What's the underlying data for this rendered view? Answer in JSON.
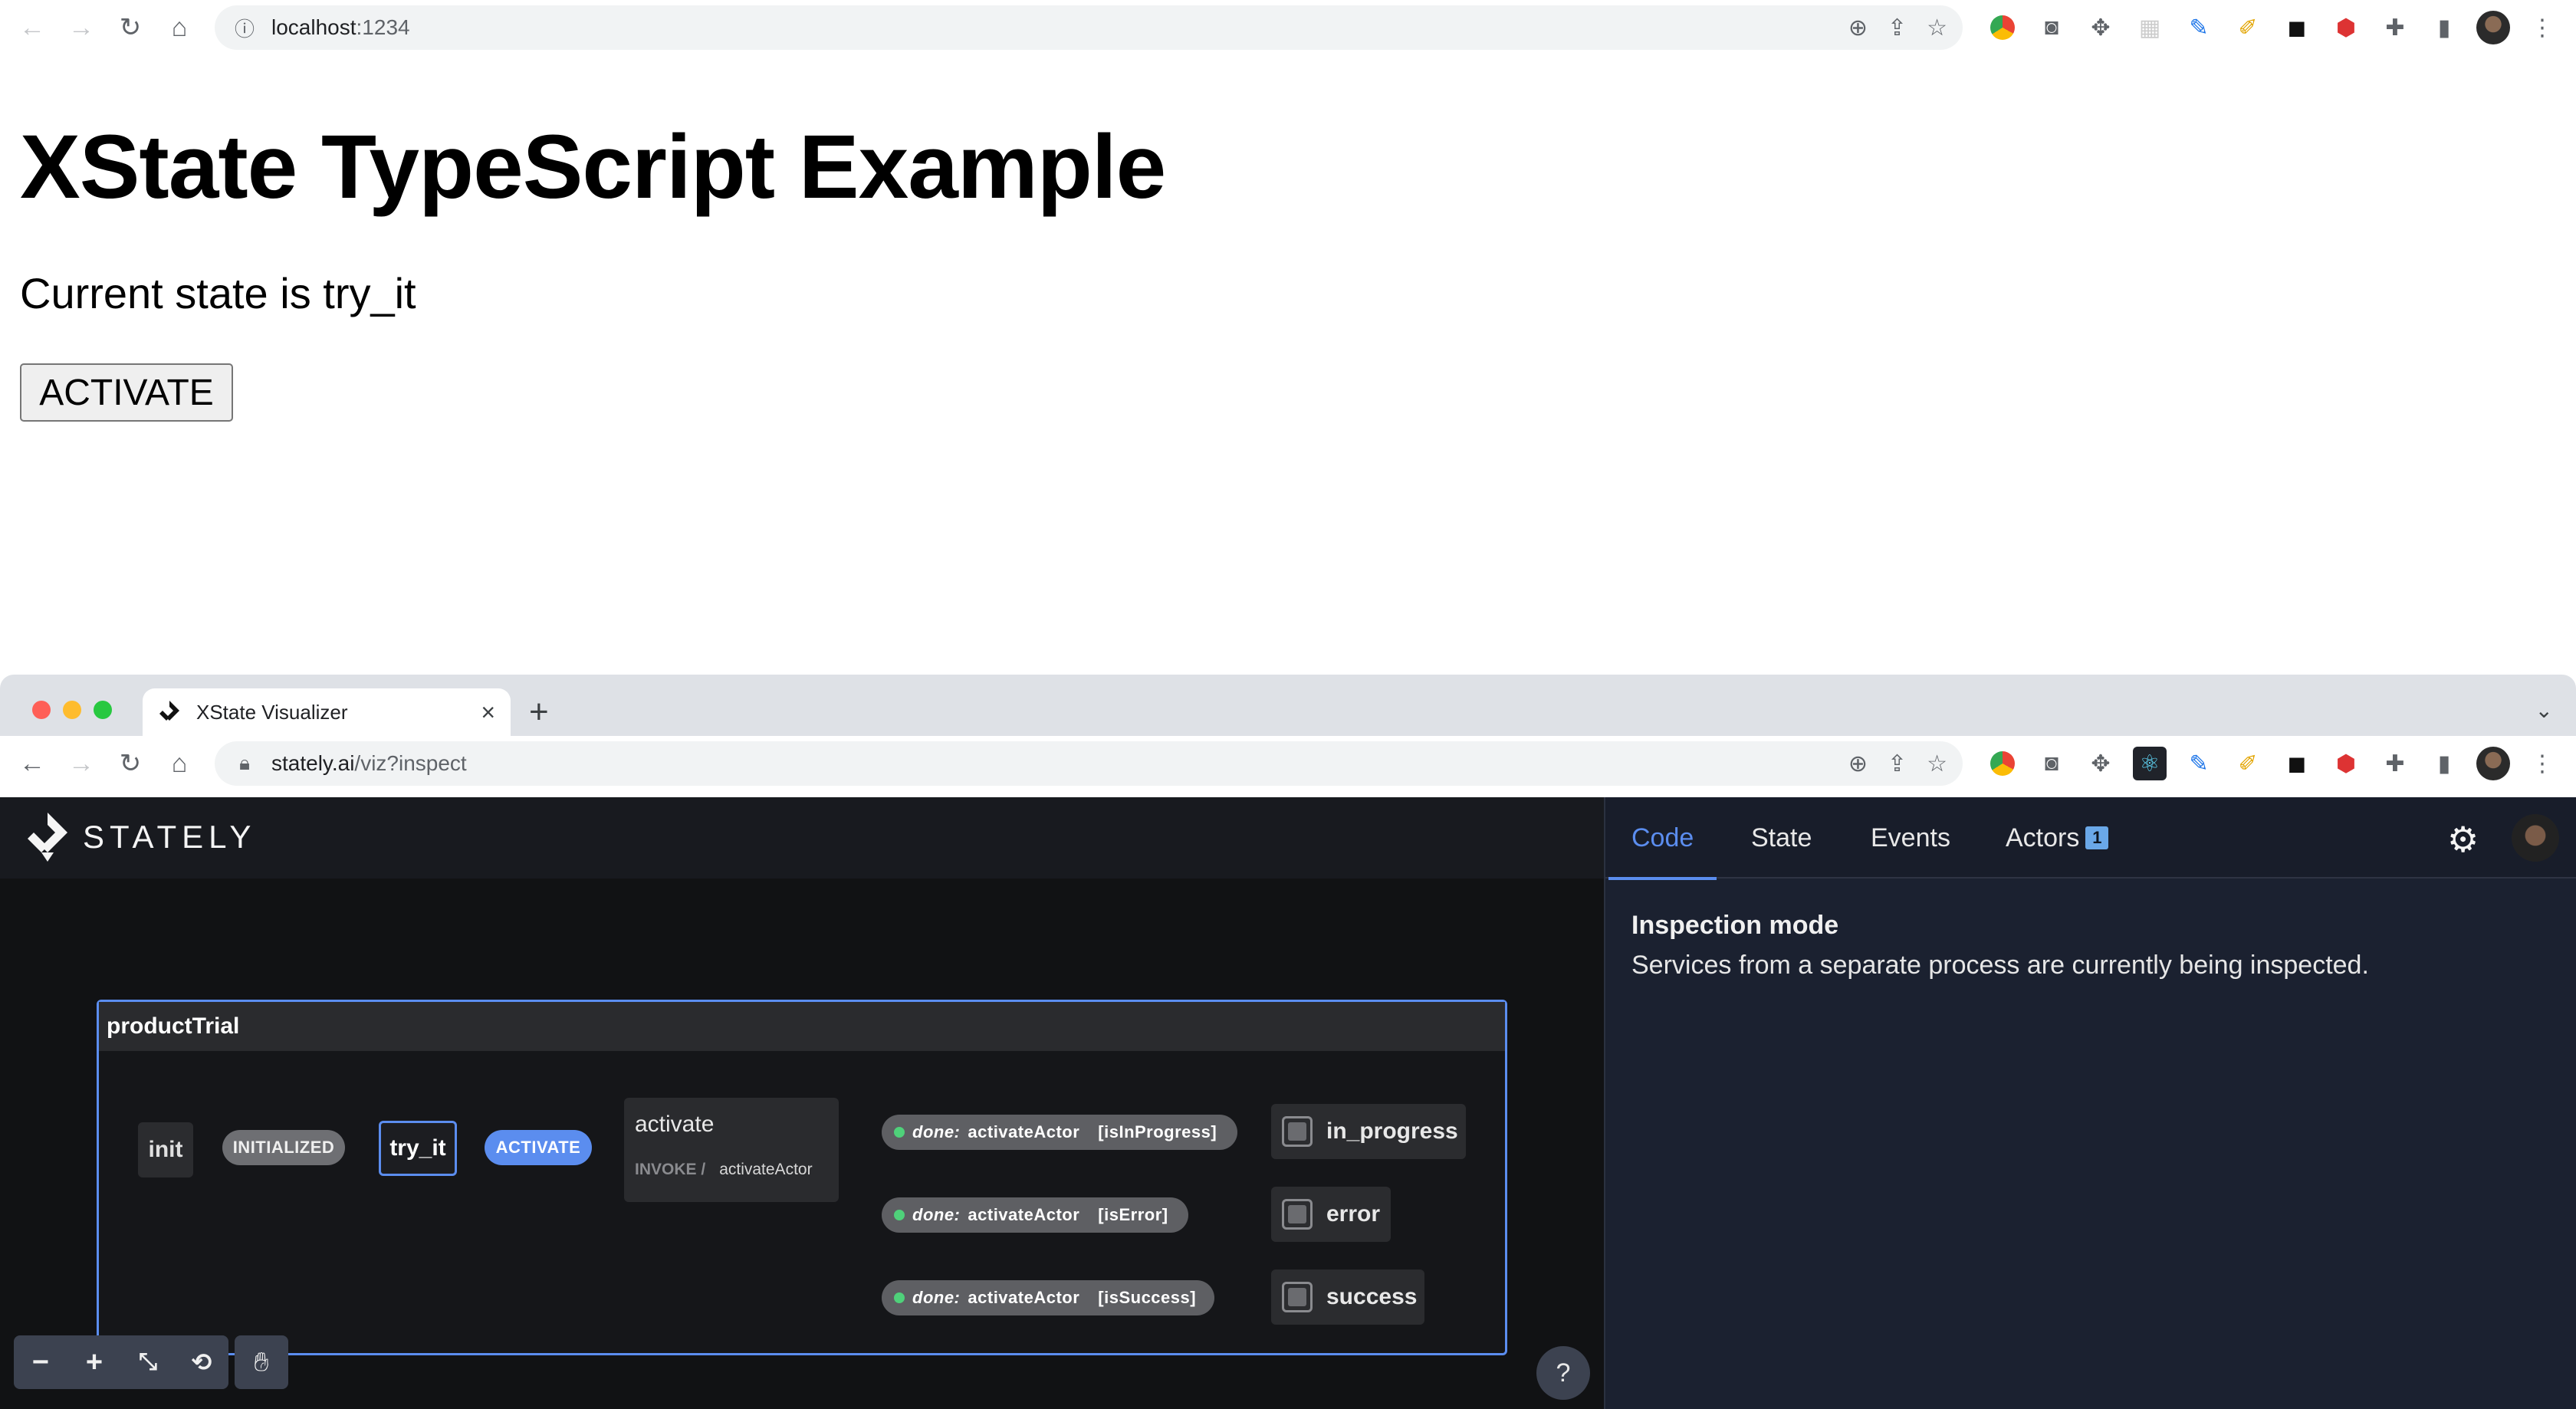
{
  "top_browser": {
    "url_host": "localhost",
    "url_port": ":1234"
  },
  "app": {
    "title": "XState TypeScript Example",
    "state_text": "Current state is try_it",
    "activate_button": "ACTIVATE"
  },
  "viz_browser": {
    "tab_title": "XState Visualizer",
    "url_host": "stately.ai",
    "url_path": "/viz?inspect"
  },
  "stately": {
    "logo_text": "STATELY",
    "tabs": [
      {
        "label": "Code",
        "active": true
      },
      {
        "label": "State",
        "active": false
      },
      {
        "label": "Events",
        "active": false
      },
      {
        "label": "Actors",
        "active": false,
        "badge": "1"
      }
    ],
    "inspection_title": "Inspection mode",
    "inspection_desc": "Services from a separate process are currently being inspected.",
    "help_label": "?"
  },
  "machine": {
    "name": "productTrial",
    "states": {
      "init": "init",
      "try_it": "try_it",
      "activate": "activate",
      "invoke_label": "INVOKE /",
      "invoke_actor": "activateActor",
      "in_progress": "in_progress",
      "error": "error",
      "success": "success"
    },
    "events": {
      "initialized": "INITIALIZED",
      "activate": "ACTIVATE"
    },
    "done_transitions": [
      {
        "prefix": "done:",
        "actor": "activateActor",
        "guard": "[isInProgress]"
      },
      {
        "prefix": "done:",
        "actor": "activateActor",
        "guard": "[isError]"
      },
      {
        "prefix": "done:",
        "actor": "activateActor",
        "guard": "[isSuccess]"
      }
    ]
  },
  "colors": {
    "accent_blue": "#5b8def",
    "done_dot": "#4fd17a",
    "canvas_bg": "#111214",
    "panel_bg": "#1b2130"
  }
}
